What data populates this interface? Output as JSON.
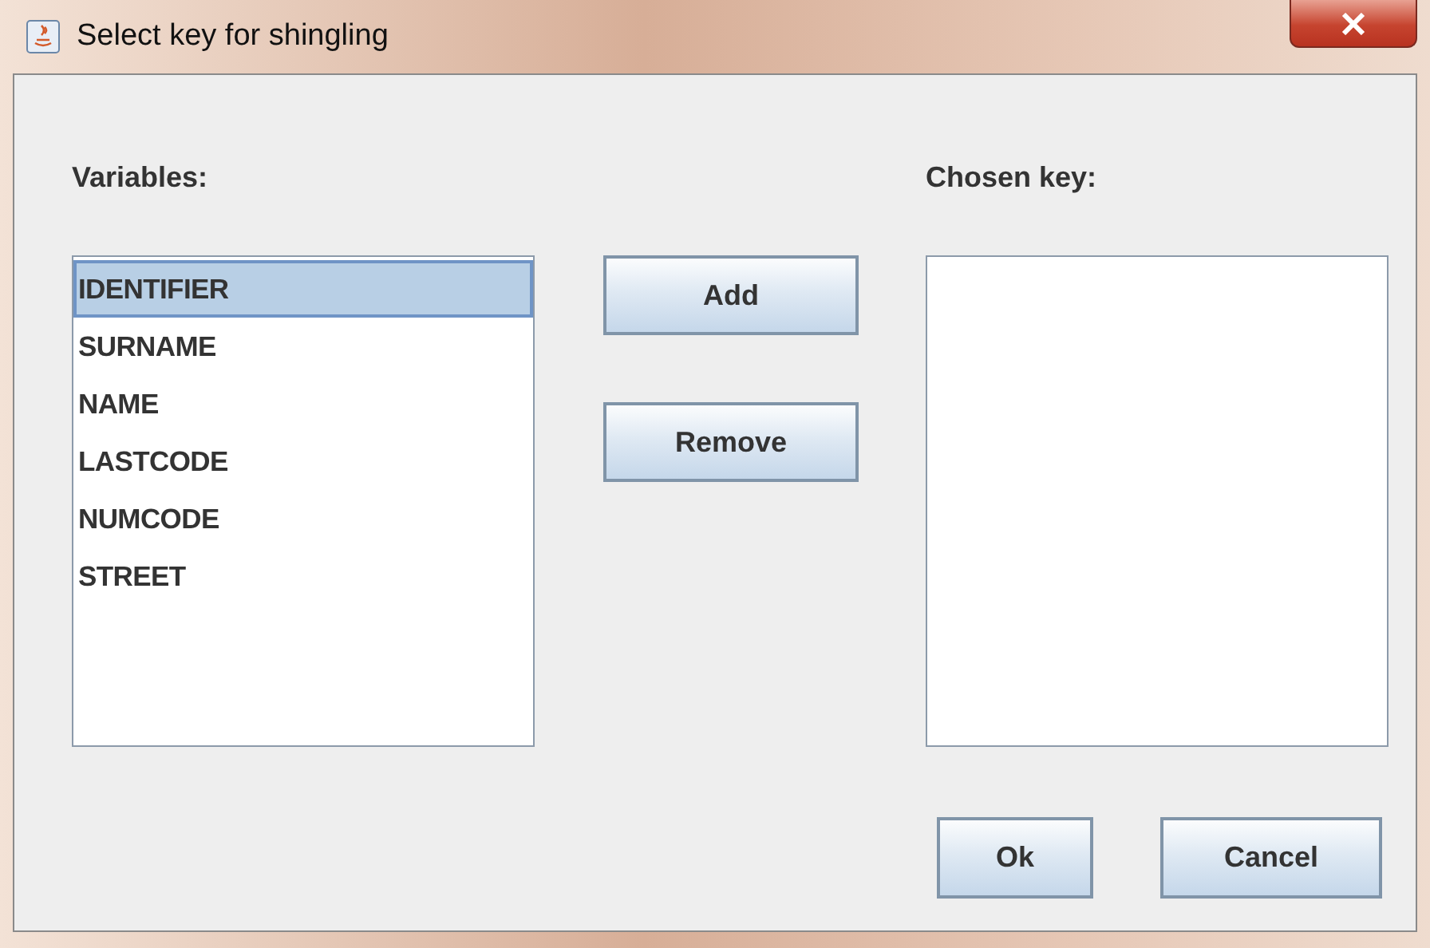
{
  "window": {
    "title": "Select key for shingling"
  },
  "variables": {
    "label": "Variables:",
    "items": [
      {
        "text": "IDENTIFIER",
        "selected": true
      },
      {
        "text": "SURNAME",
        "selected": false
      },
      {
        "text": "NAME",
        "selected": false
      },
      {
        "text": "LASTCODE",
        "selected": false
      },
      {
        "text": "NUMCODE",
        "selected": false
      },
      {
        "text": "STREET",
        "selected": false
      }
    ]
  },
  "middle_buttons": [
    "Add",
    "Remove"
  ],
  "chosen_key": {
    "label": "Chosen key:"
  },
  "buttons": [
    "Ok",
    "Cancel"
  ]
}
